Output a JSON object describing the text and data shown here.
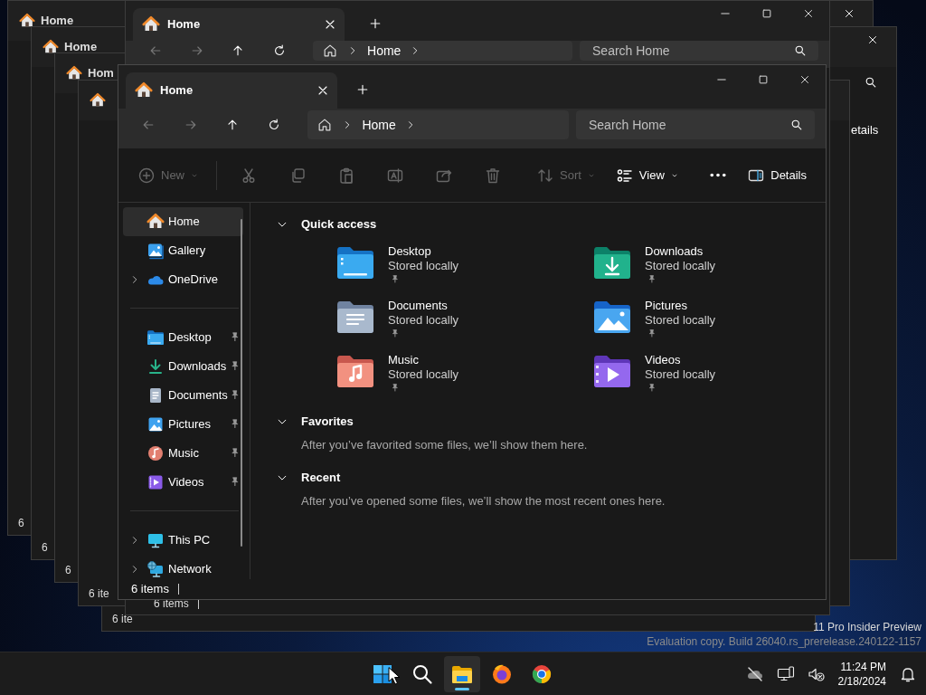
{
  "background_windows": [
    {
      "tab_label": "Home",
      "status_text": "6"
    },
    {
      "tab_label": "Home",
      "details_label": "etails",
      "status_text": "6"
    },
    {
      "tab_label": "Hom",
      "status_text": "6"
    },
    {
      "status_text": "6 ite"
    },
    {
      "status_text": "6 ite"
    },
    {
      "tab_label": "Home",
      "address": "Home",
      "search_placeholder": "Search Home",
      "status_text": "6 items"
    }
  ],
  "window": {
    "tab": {
      "label": "Home"
    },
    "address": {
      "crumbs": [
        "Home"
      ]
    },
    "search": {
      "placeholder": "Search Home"
    },
    "toolbar": [
      {
        "kind": "menu",
        "label": "New",
        "disabled": true
      },
      {
        "kind": "separator"
      },
      {
        "kind": "icon",
        "disabled": true
      },
      {
        "kind": "icon",
        "disabled": true
      },
      {
        "kind": "icon",
        "disabled": true
      },
      {
        "kind": "icon",
        "disabled": true
      },
      {
        "kind": "icon",
        "disabled": true
      },
      {
        "kind": "icon",
        "disabled": true
      },
      {
        "kind": "menu",
        "label": "Sort",
        "disabled": true
      },
      {
        "kind": "menu",
        "label": "View",
        "disabled": false
      },
      {
        "kind": "more"
      },
      {
        "kind": "toggle",
        "label": "Details"
      }
    ],
    "sidebar": {
      "groups": [
        {
          "items": [
            {
              "label": "Home",
              "selected": true,
              "has_children": false,
              "pinned": false
            },
            {
              "label": "Gallery",
              "selected": false,
              "has_children": false,
              "pinned": false
            },
            {
              "label": "OneDrive",
              "selected": false,
              "has_children": true,
              "pinned": false
            }
          ]
        },
        {
          "items": [
            {
              "label": "Desktop",
              "selected": false,
              "has_children": false,
              "pinned": true
            },
            {
              "label": "Downloads",
              "selected": false,
              "has_children": false,
              "pinned": true
            },
            {
              "label": "Documents",
              "selected": false,
              "has_children": false,
              "pinned": true
            },
            {
              "label": "Pictures",
              "selected": false,
              "has_children": false,
              "pinned": true
            },
            {
              "label": "Music",
              "selected": false,
              "has_children": false,
              "pinned": true
            },
            {
              "label": "Videos",
              "selected": false,
              "has_children": false,
              "pinned": true
            }
          ]
        },
        {
          "items": [
            {
              "label": "This PC",
              "selected": false,
              "has_children": true,
              "pinned": false
            },
            {
              "label": "Network",
              "selected": false,
              "has_children": true,
              "pinned": false
            }
          ]
        }
      ]
    },
    "sections": [
      {
        "title": "Quick access",
        "expanded": true,
        "items": [
          {
            "name": "Desktop",
            "detail": "Stored locally",
            "pinned": true
          },
          {
            "name": "Downloads",
            "detail": "Stored locally",
            "pinned": true
          },
          {
            "name": "Documents",
            "detail": "Stored locally",
            "pinned": true
          },
          {
            "name": "Pictures",
            "detail": "Stored locally",
            "pinned": true
          },
          {
            "name": "Music",
            "detail": "Stored locally",
            "pinned": true
          },
          {
            "name": "Videos",
            "detail": "Stored locally",
            "pinned": true
          }
        ]
      },
      {
        "title": "Favorites",
        "expanded": true,
        "message": "After you’ve favorited some files, we’ll show them here."
      },
      {
        "title": "Recent",
        "expanded": true,
        "message": "After you’ve opened some files, we’ll show the most recent ones here."
      }
    ],
    "status_bar": {
      "text": "6 items"
    }
  },
  "watermark": {
    "line_1": "11 Pro Insider Preview",
    "line_2": "Evaluation copy. Build 26040.rs_prerelease.240122-1157"
  },
  "taskbar": {
    "apps": [
      {
        "selected": false
      },
      {
        "selected": false
      },
      {
        "selected": true
      },
      {
        "selected": false
      },
      {
        "selected": false
      }
    ],
    "clock": {
      "time": "11:24 PM",
      "date": "2/18/2024"
    }
  }
}
